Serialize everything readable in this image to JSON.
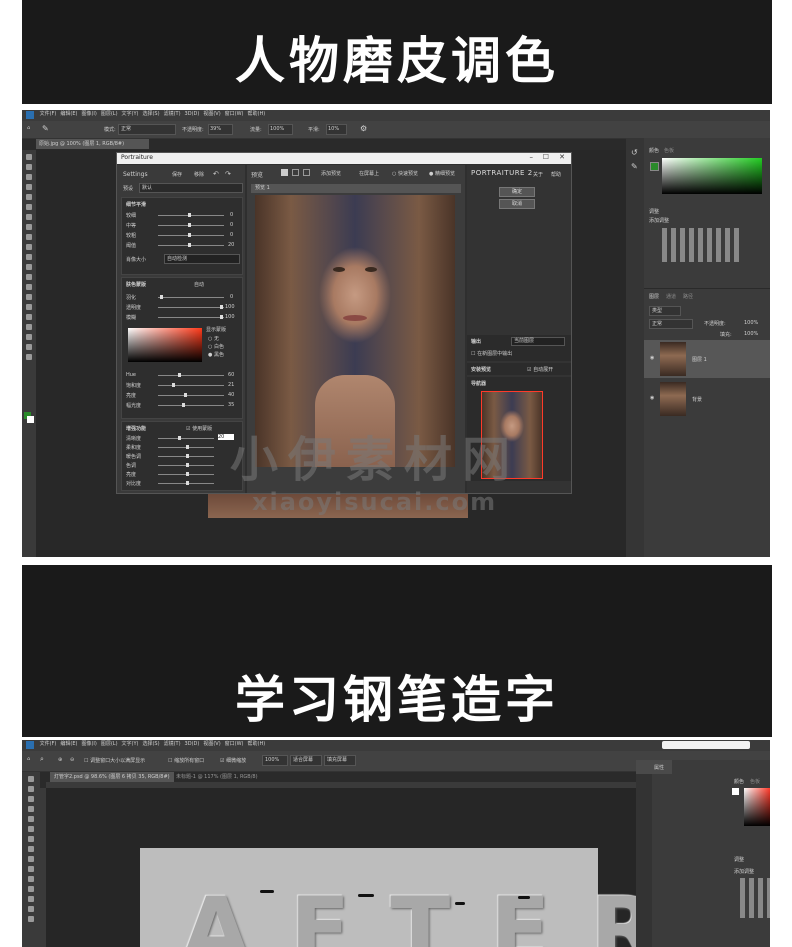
{
  "banner1": {
    "title": "人物磨皮调色"
  },
  "banner2": {
    "title": "学习钢笔造字"
  },
  "shot1": {
    "menu": [
      "文件(F)",
      "编辑(E)",
      "图像(I)",
      "图层(L)",
      "文字(Y)",
      "选择(S)",
      "滤镜(T)",
      "3D(D)",
      "视图(V)",
      "窗口(W)",
      "帮助(H)"
    ],
    "doc_tab": "原始.jpg @ 100% (图层 1, RGB/8#)",
    "options": {
      "mode_label": "模式:",
      "mode_value": "正常",
      "opacity_label": "不透明度:",
      "opacity_value": "39%",
      "flow_label": "流量:",
      "flow_value": "100%",
      "smooth_label": "平滑:",
      "smooth_value": "10%"
    },
    "dialog": {
      "title": "Portraiture",
      "settings_label": "Settings",
      "save_label": "保存",
      "delete_label": "移除",
      "preset_label": "预设",
      "preset_value": "默认",
      "preview_label": "预览",
      "add_preview": "添加预览",
      "before_after": "在屏幕上",
      "quick_preview": "快速预览",
      "fine_preview": "精细预览",
      "preview_tab": "预览 1",
      "detail_header": "细节平滑",
      "detail_rows": [
        {
          "label": "较细",
          "value": "0"
        },
        {
          "label": "中等",
          "value": "0"
        },
        {
          "label": "较粗",
          "value": "0"
        },
        {
          "label": "阈值",
          "value": "20"
        }
      ],
      "size_label": "肖像大小",
      "size_value": "自动检测",
      "skin_header": "肤色蒙版",
      "skin_mode": "自动",
      "skin_rows": [
        {
          "label": "羽化",
          "value": "0"
        },
        {
          "label": "透明度",
          "value": "100"
        },
        {
          "label": "模糊",
          "value": "100"
        }
      ],
      "show_mask": "显示蒙版",
      "mask_options": [
        "无",
        "白色",
        "黑色"
      ],
      "hsb_rows": [
        {
          "label": "Hue",
          "value": "60"
        },
        {
          "label": "饱和度",
          "value": "21"
        },
        {
          "label": "亮度",
          "value": "40"
        },
        {
          "label": "幅光度",
          "value": "35"
        }
      ],
      "enhance_header": "增强功能",
      "use_mask": "使用蒙版",
      "enhance_rows": [
        {
          "label": "清晰度",
          "value": "20"
        },
        {
          "label": "柔和度",
          "value": ""
        },
        {
          "label": "暖色调",
          "value": ""
        },
        {
          "label": "色调",
          "value": ""
        },
        {
          "label": "亮度",
          "value": ""
        },
        {
          "label": "对比度",
          "value": ""
        }
      ],
      "brand": "PORTRAITURE 2",
      "about": "关于",
      "help": "帮助",
      "ok": "确定",
      "cancel": "取消",
      "output_label": "输出",
      "output_value": "当前图层",
      "output_check": "在新图层中输出",
      "auto_preview": "安装预览",
      "auto_open": "自动展开",
      "navigator": "导航器"
    },
    "layers": {
      "tabs": [
        "图层",
        "通道",
        "路径"
      ],
      "kind": "类型",
      "blend": "正常",
      "opacity_label": "不透明度:",
      "opacity_value": "100%",
      "fill_label": "填充:",
      "fill_value": "100%",
      "items": [
        {
          "name": "图层 1"
        },
        {
          "name": "背景"
        }
      ]
    },
    "color_tabs": [
      "颜色",
      "色板"
    ],
    "adjust_label": "调整",
    "adjust_add": "添加调整"
  },
  "shot2": {
    "menu": [
      "文件(F)",
      "编辑(E)",
      "图像(I)",
      "图层(L)",
      "文字(Y)",
      "选择(S)",
      "滤镜(T)",
      "3D(D)",
      "视图(V)",
      "窗口(W)",
      "帮助(H)"
    ],
    "tabs": [
      "灯管字2.psd @ 98.6% (图层 6 拷贝 35, RGB/8#)",
      "未标题-1 @ 117% (图层 1, RGB/8)"
    ],
    "options": {
      "resize": "调整窗口大小以满屏显示",
      "all_windows": "缩放所有窗口",
      "scrubby": "细微缩放",
      "zoom": "100%",
      "fit": "适合屏幕",
      "fill": "填充屏幕"
    },
    "props": "属性",
    "color_tabs": [
      "颜色",
      "色板"
    ],
    "adjust_label": "调整",
    "adjust_add": "添加调整",
    "canvas_text": "AFTER"
  },
  "watermark": {
    "cn": "小伊素材网",
    "en": "xiaoyisucai.com"
  }
}
